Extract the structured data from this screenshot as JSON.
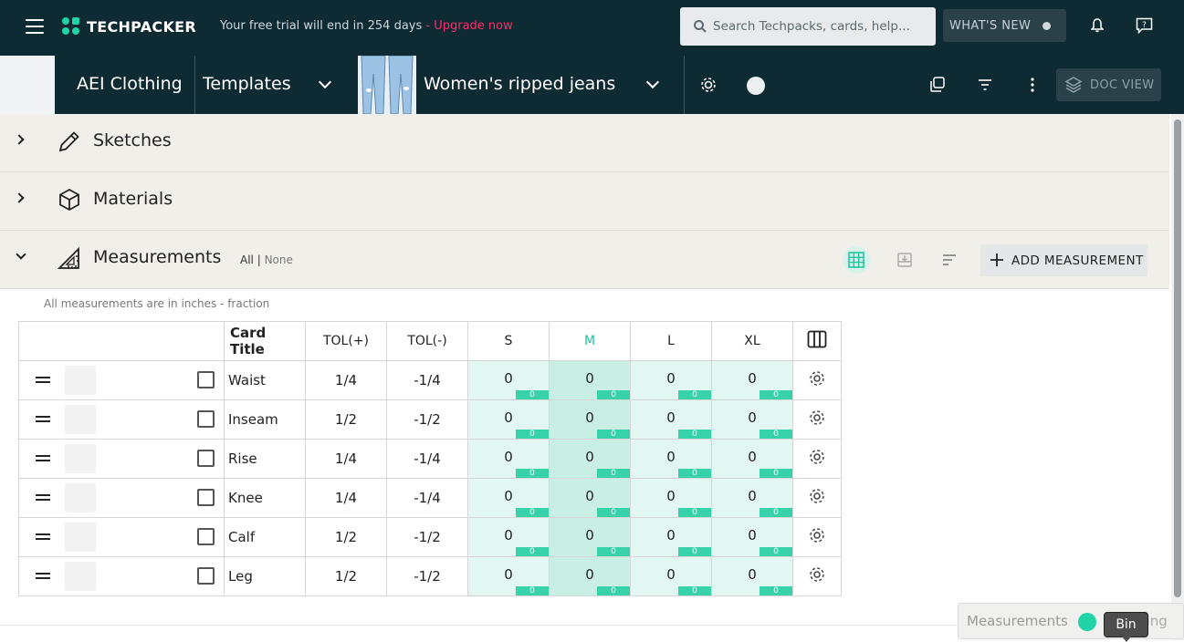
{
  "topbar": {
    "logo_text": "TECHPACKER",
    "trial_text": "Your free trial will end in 254 days",
    "upgrade_text": "- Upgrade now",
    "search_placeholder": "Search Techpacks, cards, help...",
    "whats_new_label": "WHAT'S NEW",
    "icons": [
      "menu-icon",
      "bell-icon",
      "help-chat-icon"
    ],
    "colors": {
      "background": "#0e2a33",
      "accent": "#21d4a8",
      "upgrade": "#ff2b6a"
    }
  },
  "docbar": {
    "brand": "AEI Clothing",
    "folder": "Templates",
    "product": "Women's ripped jeans",
    "doc_view_label": "DOC VIEW",
    "icons": [
      "settings-icon",
      "status-circle-icon",
      "duplicate-icon",
      "filter-icon",
      "more-vert-icon",
      "layers-icon"
    ]
  },
  "sections": [
    {
      "title": "Sketches",
      "icon": "pencil-icon",
      "expanded": false
    },
    {
      "title": "Materials",
      "icon": "cube-icon",
      "expanded": false
    },
    {
      "title": "Measurements",
      "icon": "ruler-triangle-icon",
      "expanded": true
    }
  ],
  "measurements": {
    "all_label": "All |",
    "none_label": "None",
    "add_label": "ADD MEASUREMENT",
    "note": "All measurements are in inches - fraction",
    "headers": {
      "title": "Card Title",
      "tol_plus": "TOL(+)",
      "tol_minus": "TOL(-)",
      "sizes": [
        "S",
        "M",
        "L",
        "XL"
      ]
    },
    "rows": [
      {
        "title": "Waist",
        "tol_plus": "1/4",
        "tol_minus": "-1/4",
        "values": [
          "0",
          "0",
          "0",
          "0"
        ],
        "badges": [
          "0",
          "0",
          "0",
          "0"
        ]
      },
      {
        "title": "Inseam",
        "tol_plus": "1/2",
        "tol_minus": "-1/2",
        "values": [
          "0",
          "0",
          "0",
          "0"
        ],
        "badges": [
          "0",
          "0",
          "0",
          "0"
        ]
      },
      {
        "title": "Rise",
        "tol_plus": "1/4",
        "tol_minus": "-1/4",
        "values": [
          "0",
          "0",
          "0",
          "0"
        ],
        "badges": [
          "0",
          "0",
          "0",
          "0"
        ]
      },
      {
        "title": "Knee",
        "tol_plus": "1/4",
        "tol_minus": "-1/4",
        "values": [
          "0",
          "0",
          "0",
          "0"
        ],
        "badges": [
          "0",
          "0",
          "0",
          "0"
        ]
      },
      {
        "title": "Calf",
        "tol_plus": "1/2",
        "tol_minus": "-1/2",
        "values": [
          "0",
          "0",
          "0",
          "0"
        ],
        "badges": [
          "0",
          "0",
          "0",
          "0"
        ]
      },
      {
        "title": "Leg",
        "tol_plus": "1/2",
        "tol_minus": "-1/2",
        "values": [
          "0",
          "0",
          "0",
          "0"
        ],
        "badges": [
          "0",
          "0",
          "0",
          "0"
        ]
      }
    ]
  },
  "floating": {
    "label": "Measurements",
    "label2": "ding",
    "tooltip": "Bin"
  }
}
